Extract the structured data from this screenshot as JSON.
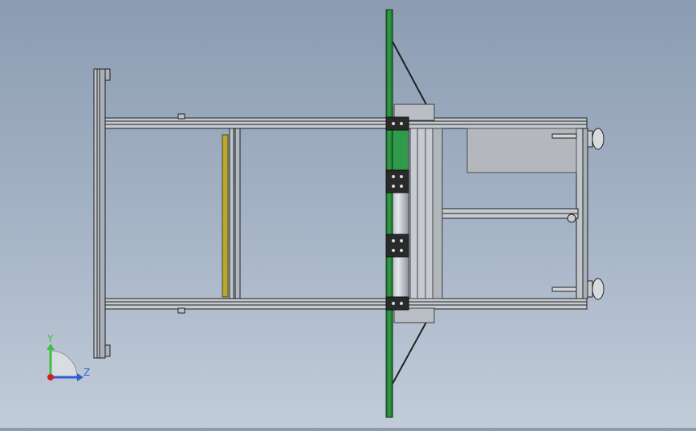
{
  "window": {
    "title": "",
    "view_orientation": "side view",
    "background_top": "#8b9cb2",
    "background_bottom": "#c2ccd9"
  },
  "model": {
    "colors": {
      "frame": "#b8c0c8",
      "frame_edge": "#202020",
      "plate": "#2e7a3a",
      "plate_highlight": "#2f9a4a",
      "yellow_bar": "#b8a830",
      "bracket": "#2a2a2a",
      "motor_box": "#b4b8bc",
      "roller": "#d0d4d8"
    }
  },
  "triad": {
    "y_label": "Y",
    "z_label": "Z",
    "y_color": "#3fbf3f",
    "z_color": "#2f5fcf",
    "origin_color": "#d02020"
  }
}
